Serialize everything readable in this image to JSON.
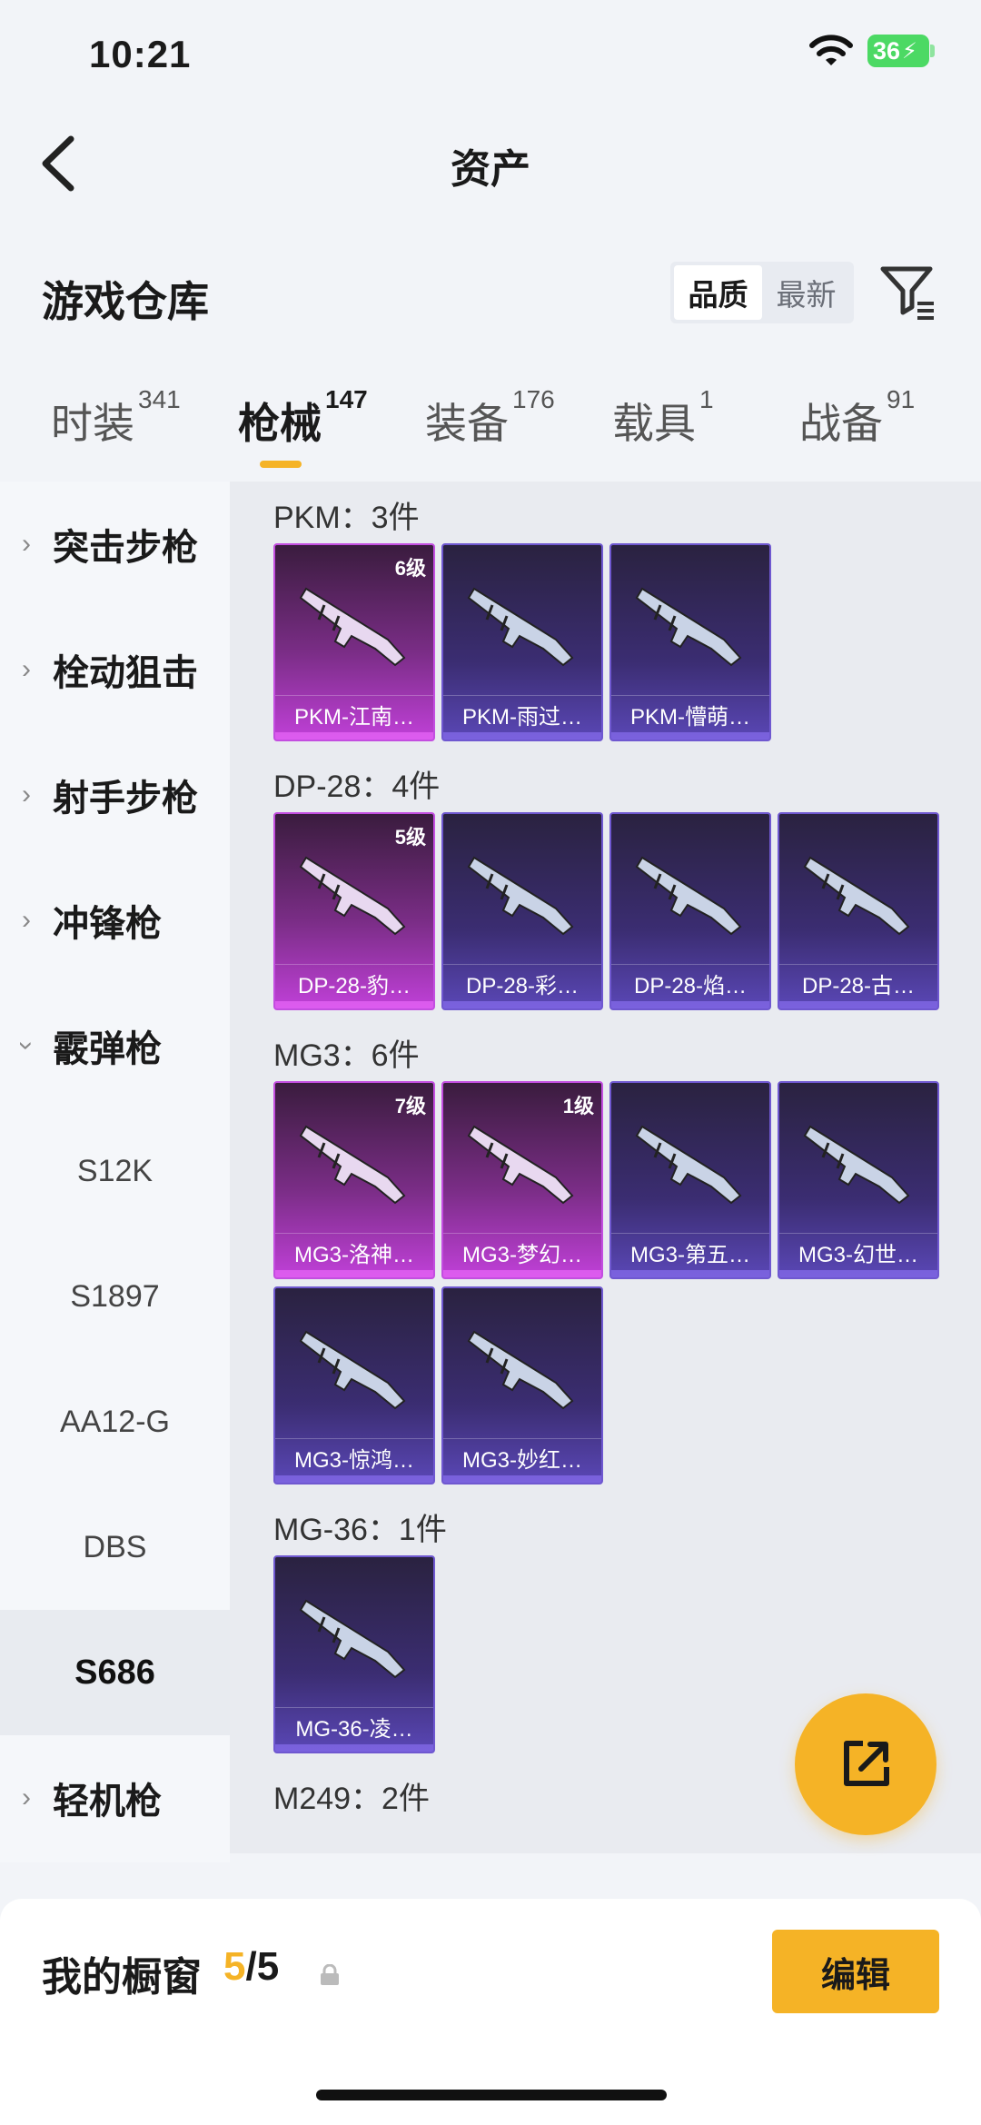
{
  "status": {
    "time": "10:21",
    "battery": "36"
  },
  "header": {
    "title": "资产"
  },
  "warehouse": {
    "title": "游戏仓库",
    "sort_options": [
      "品质",
      "最新"
    ],
    "sort_selected": "品质"
  },
  "tabs": [
    {
      "label": "时装",
      "count": "341"
    },
    {
      "label": "枪械",
      "count": "147"
    },
    {
      "label": "装备",
      "count": "176"
    },
    {
      "label": "载具",
      "count": "1"
    },
    {
      "label": "战备",
      "count": "91"
    }
  ],
  "sidebar": {
    "items": [
      {
        "label": "突击步枪"
      },
      {
        "label": "栓动狙击"
      },
      {
        "label": "射手步枪"
      },
      {
        "label": "冲锋枪"
      },
      {
        "label": "霰弹枪"
      }
    ],
    "sub_items": [
      "S12K",
      "S1897",
      "AA12-G",
      "DBS",
      "S686"
    ],
    "selected_sub": "S686",
    "last_item": {
      "label": "轻机枪"
    }
  },
  "groups": [
    {
      "title": "PKM：3件",
      "items": [
        {
          "name": "PKM-江南…",
          "level": "6级",
          "tier": "pink"
        },
        {
          "name": "PKM-雨过…",
          "level": "",
          "tier": "purple"
        },
        {
          "name": "PKM-懵萌…",
          "level": "",
          "tier": "purple"
        }
      ]
    },
    {
      "title": "DP-28：4件",
      "items": [
        {
          "name": "DP-28-豹…",
          "level": "5级",
          "tier": "pink"
        },
        {
          "name": "DP-28-彩…",
          "level": "",
          "tier": "purple"
        },
        {
          "name": "DP-28-焰…",
          "level": "",
          "tier": "purple"
        },
        {
          "name": "DP-28-古…",
          "level": "",
          "tier": "purple"
        }
      ]
    },
    {
      "title": "MG3：6件",
      "items": [
        {
          "name": "MG3-洛神…",
          "level": "7级",
          "tier": "pink"
        },
        {
          "name": "MG3-梦幻…",
          "level": "1级",
          "tier": "pink"
        },
        {
          "name": "MG3-第五…",
          "level": "",
          "tier": "purple"
        },
        {
          "name": "MG3-幻世…",
          "level": "",
          "tier": "purple"
        },
        {
          "name": "MG3-惊鸿…",
          "level": "",
          "tier": "purple"
        },
        {
          "name": "MG3-妙红…",
          "level": "",
          "tier": "purple"
        }
      ]
    },
    {
      "title": "MG-36：1件",
      "items": [
        {
          "name": "MG-36-凌…",
          "level": "",
          "tier": "purple"
        }
      ]
    },
    {
      "title": "M249：2件",
      "items": []
    }
  ],
  "bottom": {
    "showcase_label": "我的橱窗",
    "showcase_current": "5",
    "showcase_total": "/5",
    "edit_label": "编辑"
  },
  "colors": {
    "accent": "#f5b326",
    "epic": "#c34ee0",
    "rare": "#6f58d0"
  },
  "icons": [
    "back-arrow-icon",
    "filter-icon",
    "share-icon",
    "lock-icon",
    "wifi-icon"
  ]
}
